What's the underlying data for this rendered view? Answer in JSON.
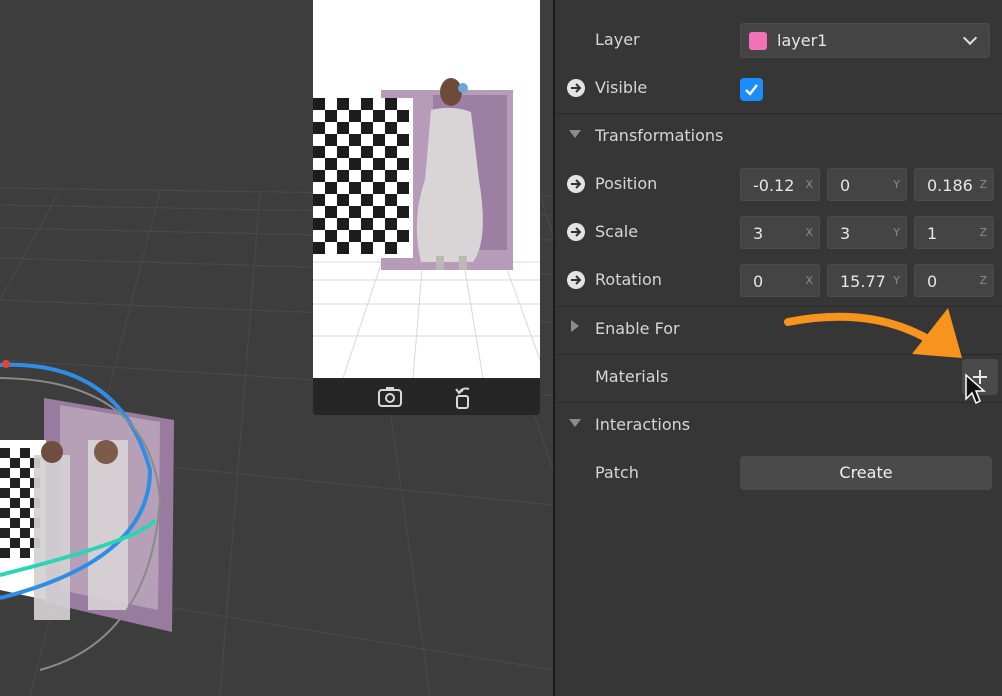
{
  "inspector": {
    "layer": {
      "label": "Layer",
      "value": "layer1",
      "swatch_color": "#f272b8"
    },
    "visible": {
      "label": "Visible",
      "checked": true
    },
    "transformations": {
      "label": "Transformations",
      "position": {
        "label": "Position",
        "x": "-0.12",
        "y": "0",
        "z": "0.186"
      },
      "scale": {
        "label": "Scale",
        "x": "3",
        "y": "3",
        "z": "1"
      },
      "rotation": {
        "label": "Rotation",
        "x": "0",
        "y": "15.77",
        "z": "0"
      },
      "axis_x": "X",
      "axis_y": "Y",
      "axis_z": "Z"
    },
    "enable_for": {
      "label": "Enable For"
    },
    "materials": {
      "label": "Materials",
      "add_icon": "plus-icon"
    },
    "interactions": {
      "label": "Interactions",
      "patch": {
        "label": "Patch",
        "button": "Create"
      }
    }
  },
  "preview": {
    "toolbar": {
      "icons": [
        "switch-camera-icon",
        "rotate-device-icon"
      ]
    }
  },
  "colors": {
    "accent_blue": "#1a8dff",
    "annotation_orange": "#f7941d",
    "layer_pink": "#f272b8"
  }
}
